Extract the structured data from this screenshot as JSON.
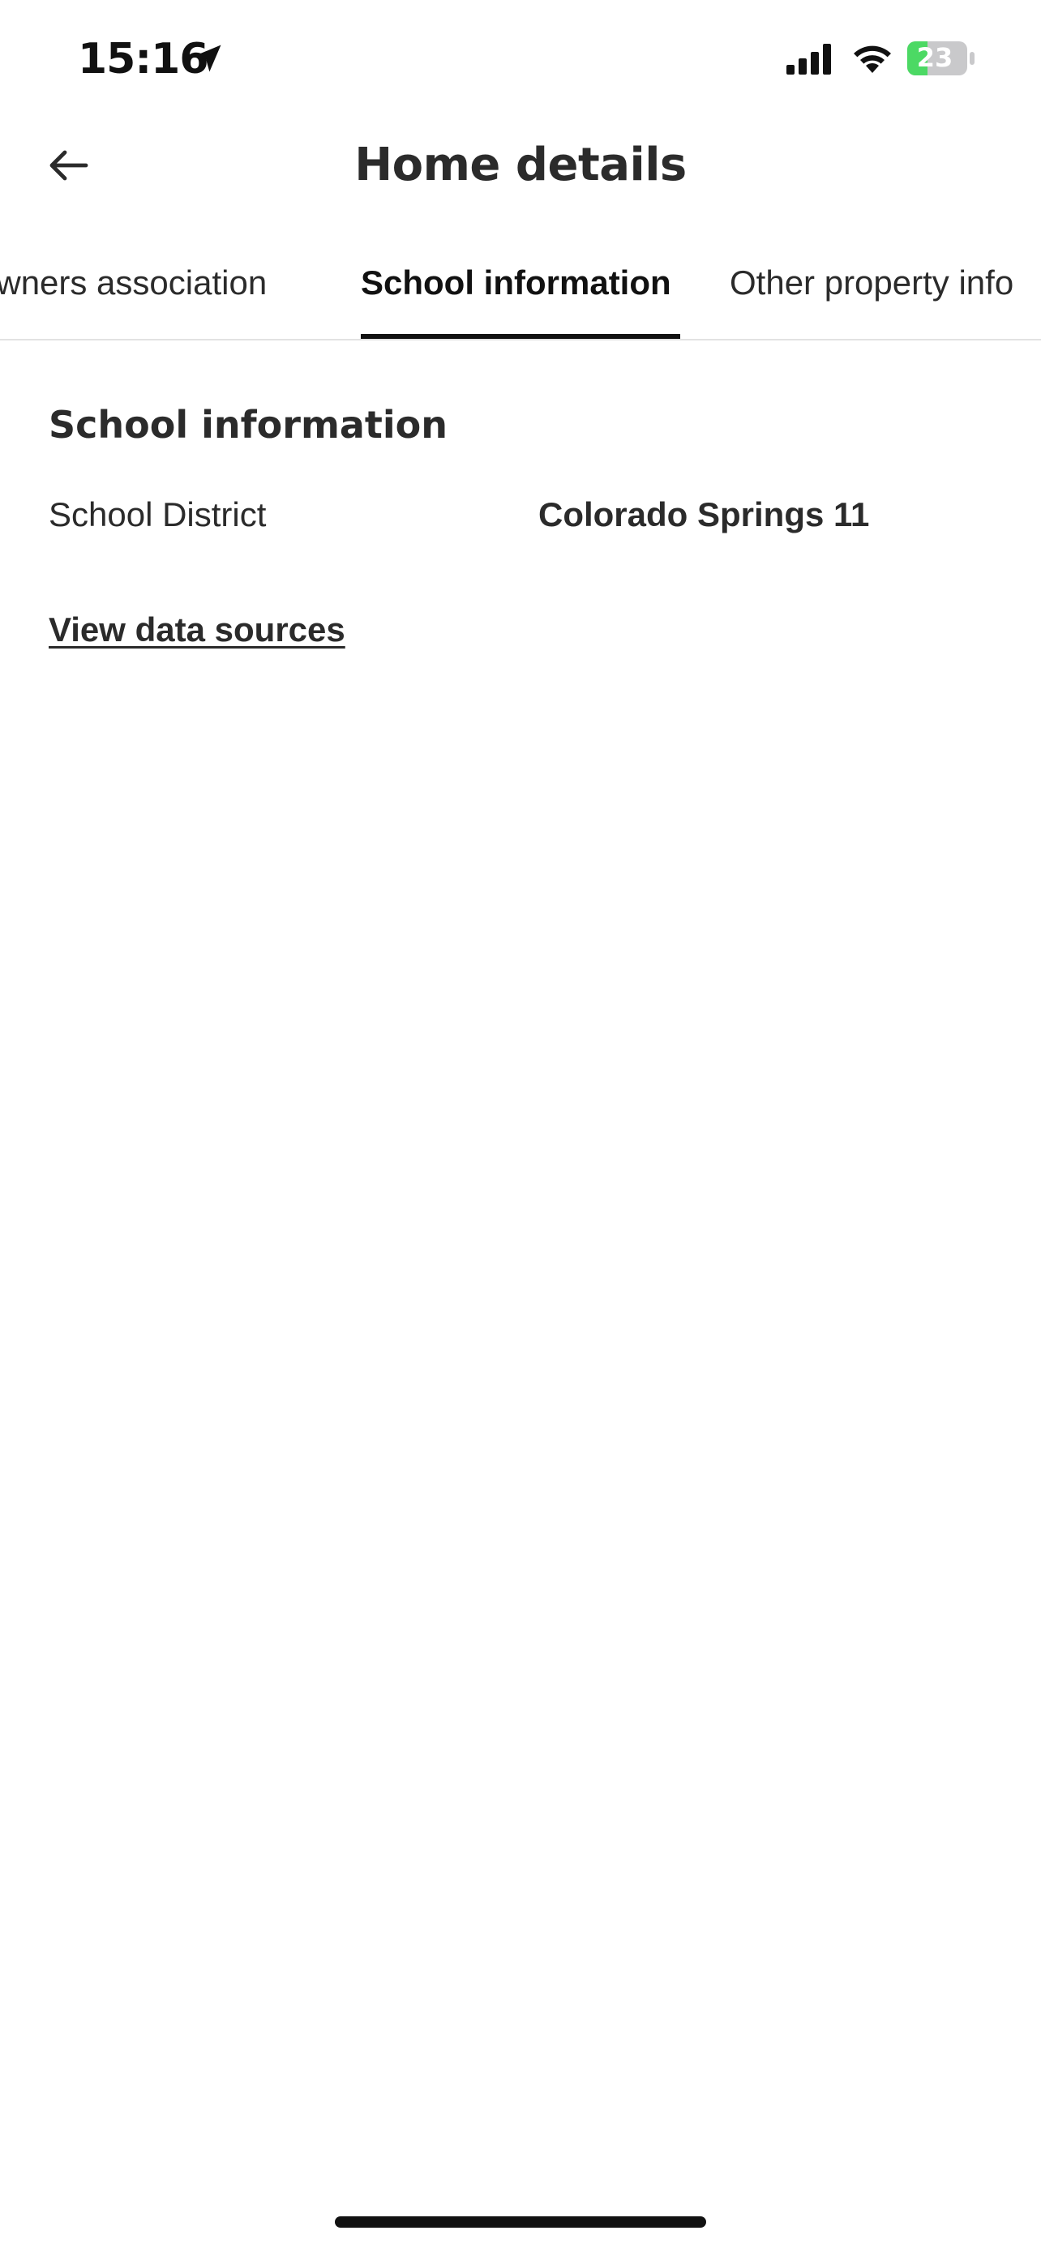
{
  "status_bar": {
    "time": "15:16",
    "battery_level": "23",
    "icons": [
      "location-arrow-icon",
      "cellular-signal-icon",
      "wifi-icon",
      "battery-charging-icon"
    ],
    "battery_color": "#4cd964"
  },
  "header": {
    "title": "Home details",
    "back_icon": "arrow-left-icon"
  },
  "tabs": [
    {
      "label": "Homeowners association",
      "visible_label": "owners association",
      "active": false
    },
    {
      "label": "School information",
      "active": true
    },
    {
      "label": "Other property info",
      "visible_label": "Other property info",
      "active": false
    }
  ],
  "section": {
    "title": "School information",
    "rows": [
      {
        "label": "School District",
        "value": "Colorado Springs 11"
      }
    ],
    "link_label": "View data sources"
  }
}
